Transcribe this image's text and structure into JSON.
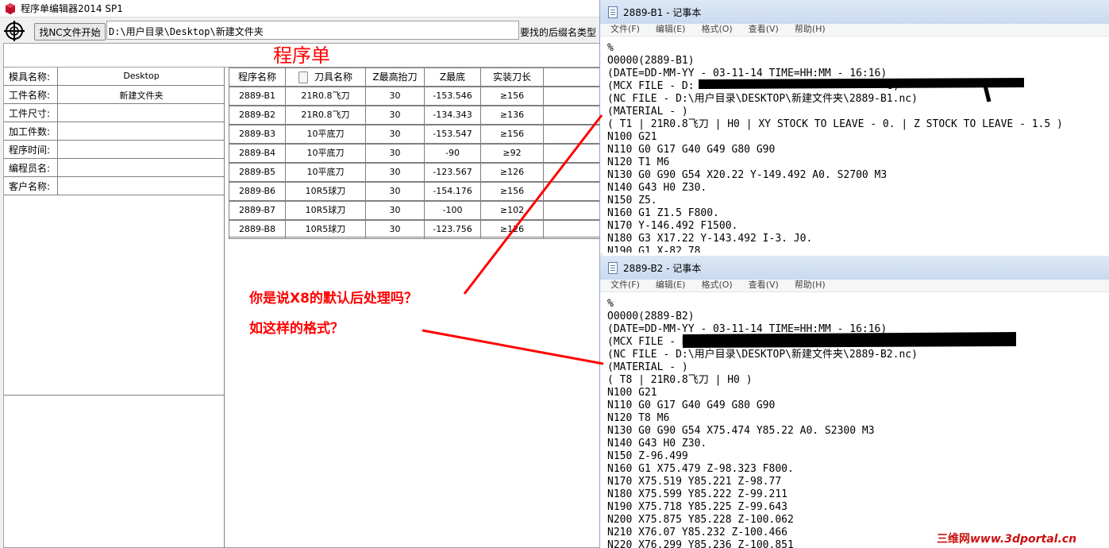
{
  "main_window": {
    "title": "程序单编辑器2014 SP1",
    "find_button_label": "找NC文件开始",
    "path_value": "D:\\用户目录\\Desktop\\新建文件夹",
    "ext_label": "要找的后缀名类型",
    "sheet_title": "程序单"
  },
  "info_panel": [
    {
      "label": "模具名称:",
      "value": "Desktop"
    },
    {
      "label": "工件名称:",
      "value": "新建文件夹"
    },
    {
      "label": "工件尺寸:",
      "value": ""
    },
    {
      "label": "加工件数:",
      "value": ""
    },
    {
      "label": "程序时间:",
      "value": ""
    },
    {
      "label": "编程员名:",
      "value": ""
    },
    {
      "label": "客户名称:",
      "value": ""
    }
  ],
  "program_table": {
    "headers": [
      "程序名称",
      "刀具名称",
      "Z最高抬刀",
      "Z最底",
      "实装刀长",
      ""
    ],
    "rows": [
      [
        "2889-B1",
        "21R0.8飞刀",
        "30",
        "-153.546",
        "≥156",
        ""
      ],
      [
        "2889-B2",
        "21R0.8飞刀",
        "30",
        "-134.343",
        "≥136",
        ""
      ],
      [
        "2889-B3",
        "10平底刀",
        "30",
        "-153.547",
        "≥156",
        ""
      ],
      [
        "2889-B4",
        "10平底刀",
        "30",
        "-90",
        "≥92",
        ""
      ],
      [
        "2889-B5",
        "10平底刀",
        "30",
        "-123.567",
        "≥126",
        ""
      ],
      [
        "2889-B6",
        "10R5球刀",
        "30",
        "-154.176",
        "≥156",
        ""
      ],
      [
        "2889-B7",
        "10R5球刀",
        "30",
        "-100",
        "≥102",
        ""
      ],
      [
        "2889-B8",
        "10R5球刀",
        "30",
        "-123.756",
        "≥126",
        ""
      ]
    ]
  },
  "notepad_b1": {
    "title": "2889-B1 - 记事本",
    "menus": [
      "文件(F)",
      "编辑(E)",
      "格式(O)",
      "查看(V)",
      "帮助(H)"
    ],
    "lines": [
      "%",
      "O0000(2889-B1)",
      "(DATE=DD-MM-YY - 03-11-14 TIME=HH:MM - 16:16)",
      "(MCX FILE - D:                               8)",
      "(NC FILE - D:\\用户目录\\DESKTOP\\新建文件夹\\2889-B1.nc)",
      "(MATERIAL - )",
      "( T1 | 21R0.8飞刀 | H0 | XY STOCK TO LEAVE - 0. | Z STOCK TO LEAVE - 1.5 )",
      "N100 G21",
      "N110 G0 G17 G40 G49 G80 G90",
      "N120 T1 M6",
      "N130 G0 G90 G54 X20.22 Y-149.492 A0. S2700 M3",
      "N140 G43 H0 Z30.",
      "N150 Z5.",
      "N160 G1 Z1.5 F800.",
      "N170 Y-146.492 F1500.",
      "N180 G3 X17.22 Y-143.492 I-3. J0.",
      "N190 G1 X-82.78"
    ]
  },
  "notepad_b2": {
    "title": "2889-B2 - 记事本",
    "menus": [
      "文件(F)",
      "编辑(E)",
      "格式(O)",
      "查看(V)",
      "帮助(H)"
    ],
    "lines": [
      "%",
      "O0000(2889-B2)",
      "(DATE=DD-MM-YY - 03-11-14 TIME=HH:MM - 16:16)",
      "(MCX FILE - D:                                 8)",
      "(NC FILE - D:\\用户目录\\DESKTOP\\新建文件夹\\2889-B2.nc)",
      "(MATERIAL - )",
      "( T8 | 21R0.8飞刀 | H0 )",
      "N100 G21",
      "N110 G0 G17 G40 G49 G80 G90",
      "N120 T8 M6",
      "N130 G0 G90 G54 X75.474 Y85.22 A0. S2300 M3",
      "N140 G43 H0 Z30.",
      "N150 Z-96.499",
      "N160 G1 X75.479 Z-98.323 F800.",
      "N170 X75.519 Y85.221 Z-98.77",
      "N180 X75.599 Y85.222 Z-99.211",
      "N190 X75.718 Y85.225 Z-99.643",
      "N200 X75.875 Y85.228 Z-100.062",
      "N210 X76.07 Y85.232 Z-100.466",
      "N220 X76.299 Y85.236 Z-100.851"
    ]
  },
  "annotation": {
    "line1": "你是说X8的默认后处理吗？",
    "line2": "如这样的格式？",
    "color": "#ff0000"
  },
  "watermark": {
    "cn": "三维网",
    "latin": "www.3dportal.cn"
  }
}
